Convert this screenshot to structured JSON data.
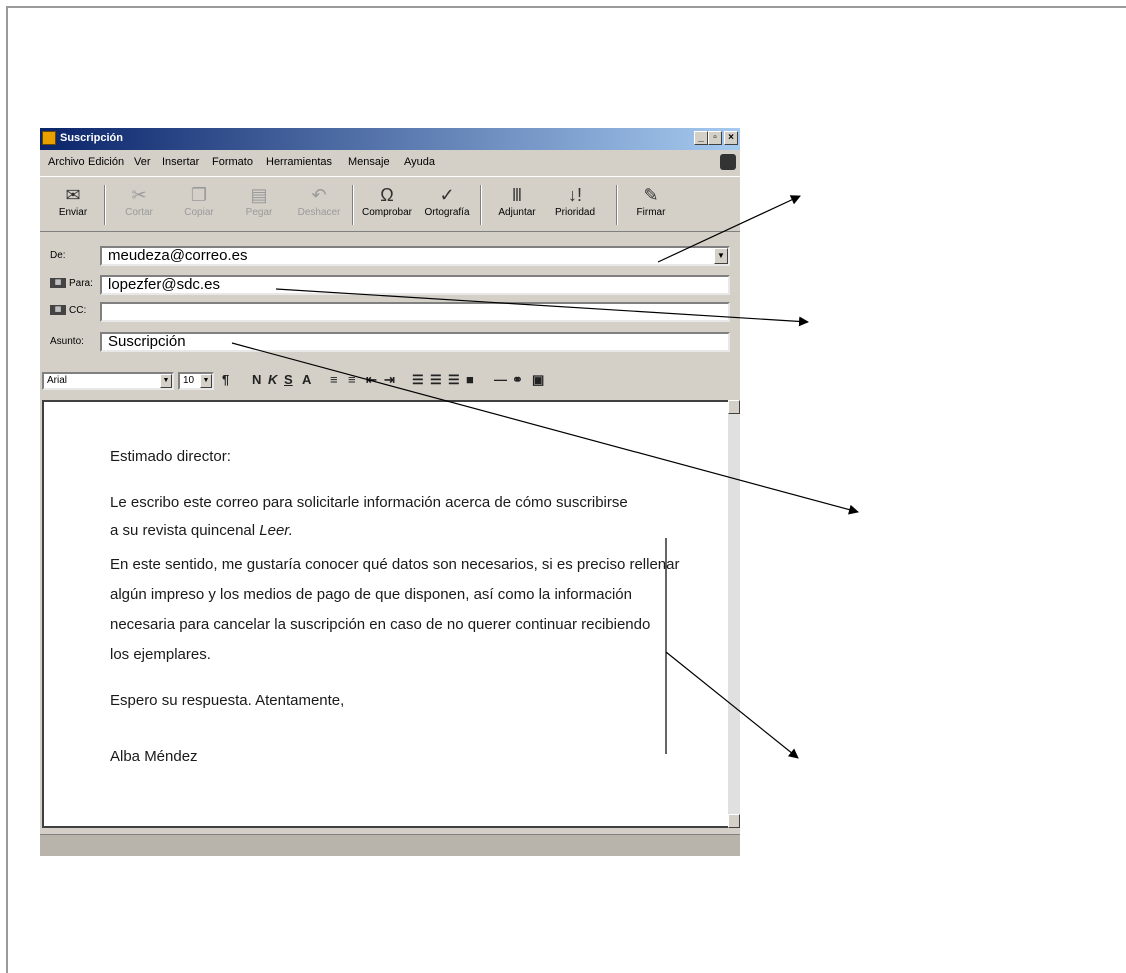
{
  "window": {
    "title": "Suscripción"
  },
  "menu": [
    "Archivo",
    "Edición",
    "Ver",
    "Insertar",
    "Formato",
    "Herramientas",
    "Mensaje",
    "Ayuda"
  ],
  "toolbar": {
    "send": "Enviar",
    "cut": "Cortar",
    "copy": "Copiar",
    "paste": "Pegar",
    "undo": "Deshacer",
    "check": "Comprobar",
    "spelling": "Ortografía",
    "attach": "Adjuntar",
    "priority": "Prioridad",
    "sign": "Firmar"
  },
  "header": {
    "from_label": "De:",
    "from_value": "meudeza@correo.es",
    "to_label": "Para:",
    "to_value": "lopezfer@sdc.es",
    "cc_label": "CC:",
    "cc_value": "",
    "subject_label": "Asunto:",
    "subject_value": "Suscripción"
  },
  "format": {
    "font": "Arial",
    "size": "10"
  },
  "body": {
    "greeting": "Estimado director:",
    "p1_line1": "Le escribo este correo para solicitarle información acerca de cómo suscribirse",
    "p1_line2a": "a su revista quincenal ",
    "p1_line2b": "Leer.",
    "p2_line1": "En este sentido, me gustaría conocer qué datos son necesarios, si es preciso rellenar",
    "p2_line2": "algún impreso y los medios de pago de que disponen, así como la información",
    "p2_line3": "necesaria para cancelar la suscripción en caso de no querer continuar recibiendo",
    "p2_line4": "los ejemplares.",
    "closing": "Espero su respuesta. Atentamente,",
    "signature": "Alba Méndez"
  }
}
